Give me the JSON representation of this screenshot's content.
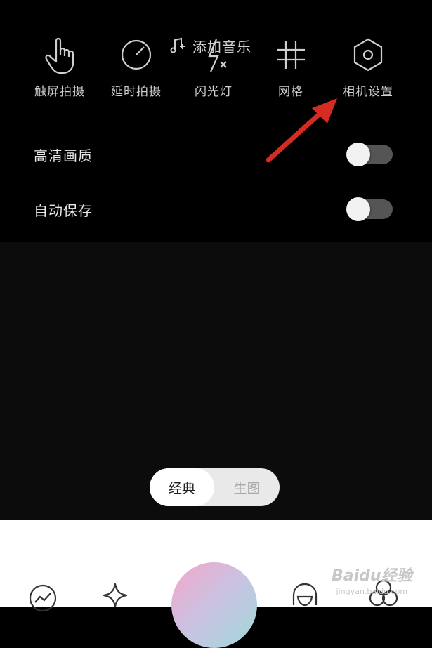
{
  "music": {
    "label": "添加音乐",
    "icon": "music-add-icon"
  },
  "tools": [
    {
      "label": "触屏拍摄",
      "icon": "touch-icon"
    },
    {
      "label": "延时拍摄",
      "icon": "timer-icon"
    },
    {
      "label": "闪光灯",
      "icon": "flash-off-icon"
    },
    {
      "label": "网格",
      "icon": "grid-icon"
    },
    {
      "label": "相机设置",
      "icon": "hexagon-settings-icon"
    }
  ],
  "settings": [
    {
      "label": "高清画质",
      "enabled": false
    },
    {
      "label": "自动保存",
      "enabled": false
    }
  ],
  "mode": {
    "active": "经典",
    "inactive": "生图"
  },
  "watermark": {
    "line1": "Baidu经验",
    "line2": "jingyan.baidu.com"
  },
  "colors": {
    "arrow": "#d42b22",
    "background": "#000000",
    "bottom_bar": "#ffffff"
  }
}
